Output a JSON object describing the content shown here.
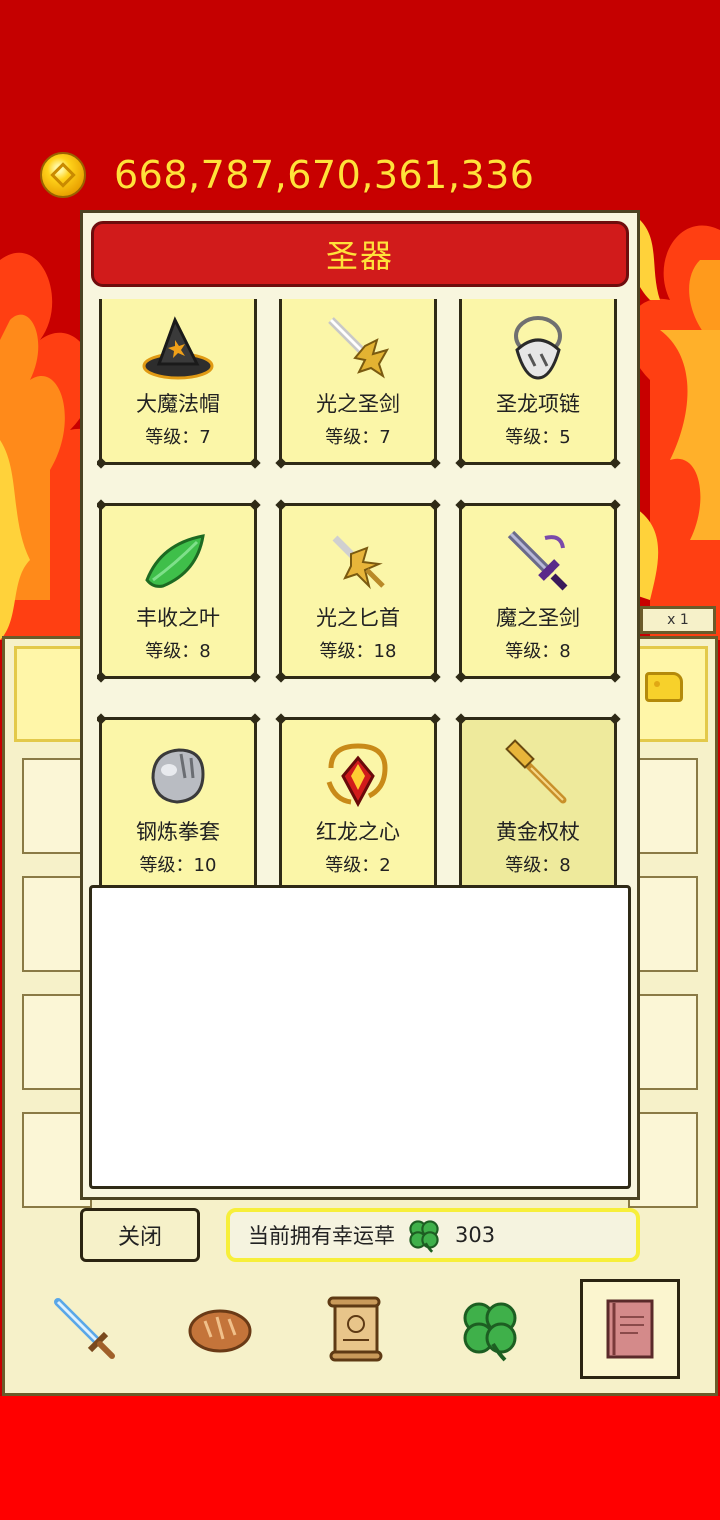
{
  "currency": {
    "icon": "gold-coin-icon",
    "amount": "668,787,670,361,336",
    "color": "#ffe23a"
  },
  "underlying_panel": {
    "tab_label": "x 1"
  },
  "dialog": {
    "title": "圣器",
    "level_prefix": "等级：",
    "items": [
      {
        "name": "大魔法帽",
        "level": "等级：7",
        "icon": "wizard-hat-icon"
      },
      {
        "name": "光之圣剑",
        "level": "等级：7",
        "icon": "holy-sword-icon"
      },
      {
        "name": "圣龙项链",
        "level": "等级：5",
        "icon": "dragon-necklace-icon"
      },
      {
        "name": "丰收之叶",
        "level": "等级：8",
        "icon": "leaf-icon"
      },
      {
        "name": "光之匕首",
        "level": "等级：18",
        "icon": "light-dagger-icon"
      },
      {
        "name": "魔之圣剑",
        "level": "等级：8",
        "icon": "dark-sword-icon"
      },
      {
        "name": "钢炼拳套",
        "level": "等级：10",
        "icon": "steel-gauntlet-icon"
      },
      {
        "name": "红龙之心",
        "level": "等级：2",
        "icon": "red-dragon-heart-icon"
      },
      {
        "name": "黄金权杖",
        "level": "等级：8",
        "icon": "golden-scepter-icon",
        "selected": true
      }
    ],
    "description": ""
  },
  "footer": {
    "close_label": "关闭",
    "clover_label": "当前拥有幸运草",
    "clover_count": "303",
    "clover_icon": "clover-icon"
  },
  "bottom_nav": [
    {
      "icon": "sword-icon"
    },
    {
      "icon": "bread-icon"
    },
    {
      "icon": "scroll-icon"
    },
    {
      "icon": "clover-icon"
    },
    {
      "icon": "book-icon",
      "active": true
    }
  ],
  "colors": {
    "background_red": "#c80000",
    "flame": "#ff3a10",
    "header_red": "#d11b1b",
    "card_yellow": "#fbf6a8"
  }
}
